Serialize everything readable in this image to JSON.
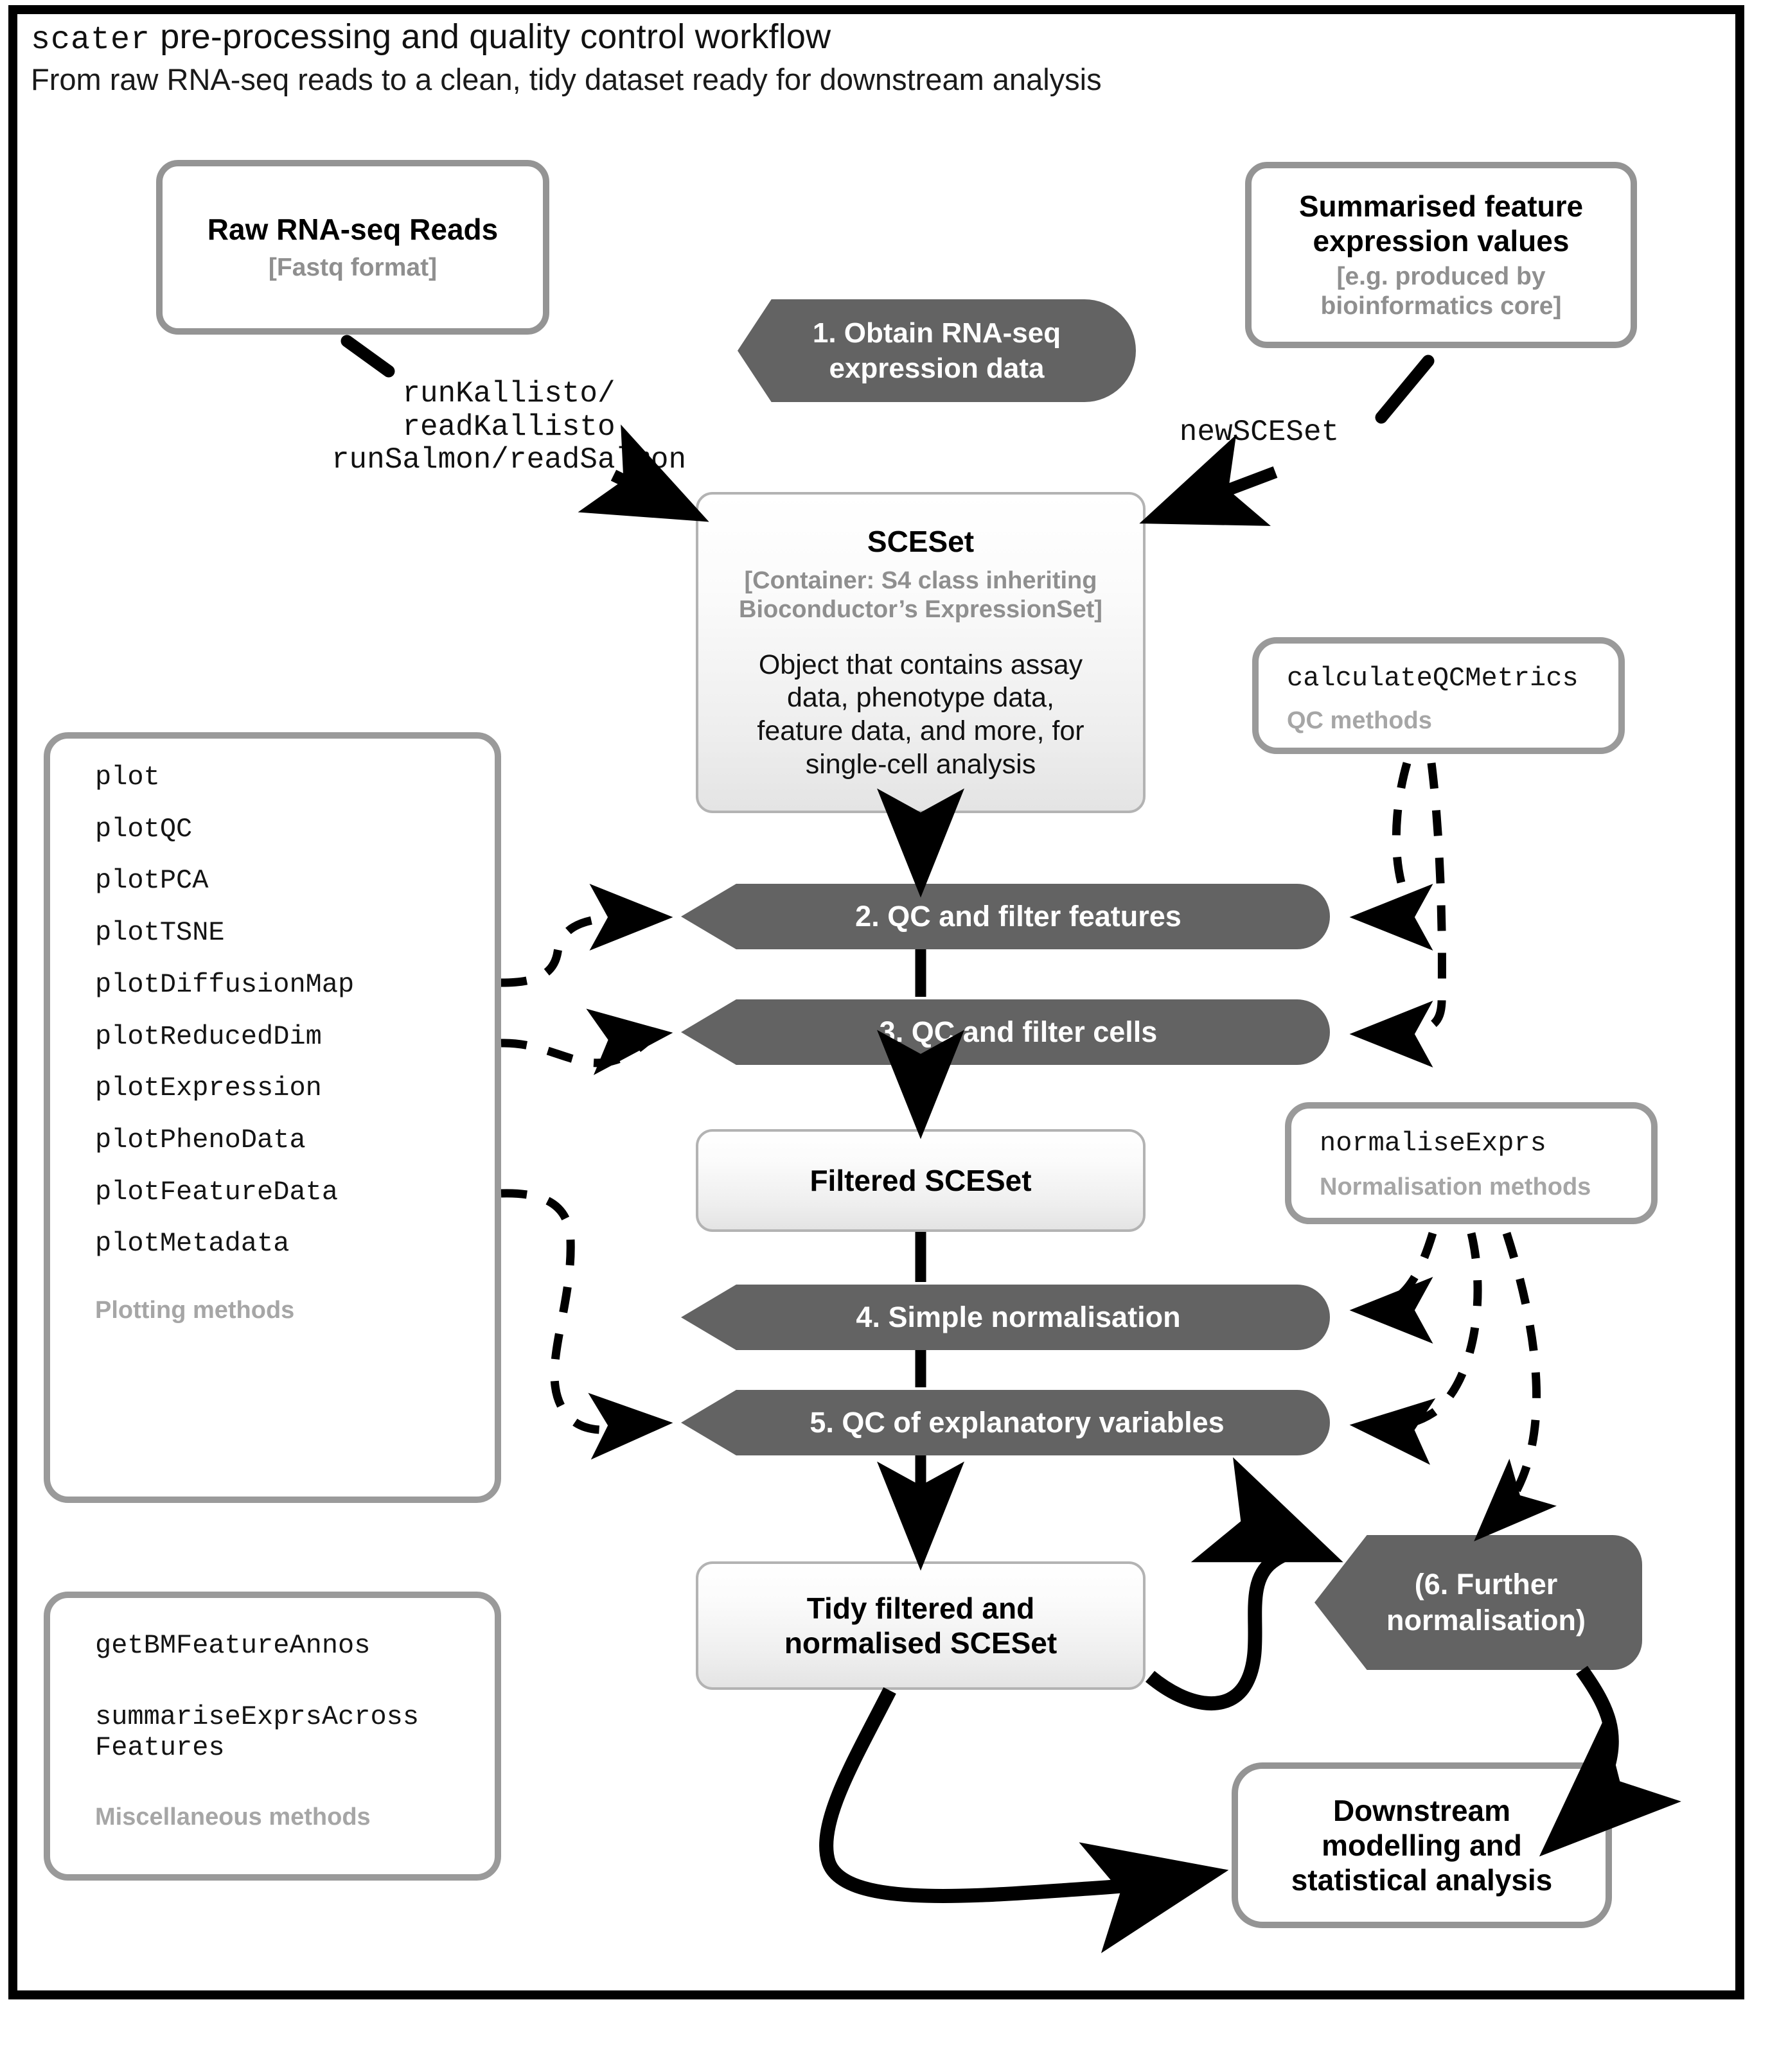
{
  "header": {
    "title_mono": "scater",
    "title_rest": " pre-processing and quality control workflow",
    "subtitle": "From raw RNA-seq reads to a clean, tidy dataset ready for downstream analysis"
  },
  "nodes": {
    "raw_reads": {
      "title": "Raw RNA-seq Reads",
      "subtitle": "[Fastq format]"
    },
    "summarised": {
      "title_line1": "Summarised feature",
      "title_line2": "expression values",
      "subtitle_line1": "[e.g. produced by",
      "subtitle_line2": "bioinformatics core]"
    },
    "step1": {
      "line1": "1. Obtain RNA-seq",
      "line2": "expression data"
    },
    "sceset": {
      "title": "SCESet",
      "subtitle_line1": "[Container: S4 class inheriting",
      "subtitle_line2": "Bioconductor’s ExpressionSet]",
      "body_line1": "Object that contains assay",
      "body_line2": "data, phenotype data,",
      "body_line3": "feature data, and more, for",
      "body_line4": "single-cell analysis"
    },
    "step2": {
      "label": "2. QC and filter features"
    },
    "step3": {
      "label": "3. QC and filter cells"
    },
    "filtered": {
      "title": "Filtered SCESet"
    },
    "step4": {
      "label": "4. Simple normalisation"
    },
    "step5": {
      "label": "5. QC of explanatory variables"
    },
    "tidy": {
      "title_line1": "Tidy filtered and",
      "title_line2": "normalised SCESet"
    },
    "step6": {
      "line1": "(6. Further",
      "line2": "normalisation)"
    },
    "downstream": {
      "line1": "Downstream",
      "line2": "modelling and",
      "line3": "statistical analysis"
    }
  },
  "method_boxes": {
    "plotting": {
      "items": [
        "plot",
        "plotQC",
        "plotPCA",
        "plotTSNE",
        "plotDiffusionMap",
        "plotReducedDim",
        "plotExpression",
        "plotPhenoData",
        "plotFeatureData",
        "plotMetadata"
      ],
      "caption": "Plotting methods"
    },
    "qc": {
      "items": [
        "calculateQCMetrics"
      ],
      "caption": "QC methods"
    },
    "normalisation": {
      "items": [
        "normaliseExprs"
      ],
      "caption": "Normalisation methods"
    },
    "misc": {
      "items": [
        "getBMFeatureAnnos",
        "summariseExprsAcross\nFeatures"
      ],
      "caption": "Miscellaneous methods"
    }
  },
  "edge_labels": {
    "kallisto_salmon": "runKallisto/\nreadKallisto\nrunSalmon/readSalmon",
    "new_sceset": "newSCESet"
  },
  "colors": {
    "frame": "#000000",
    "process_fill": "#636363",
    "box_border_grey": "#949494",
    "subtitle_grey": "#8f8f8f",
    "caption_grey": "#a6a6a6"
  }
}
